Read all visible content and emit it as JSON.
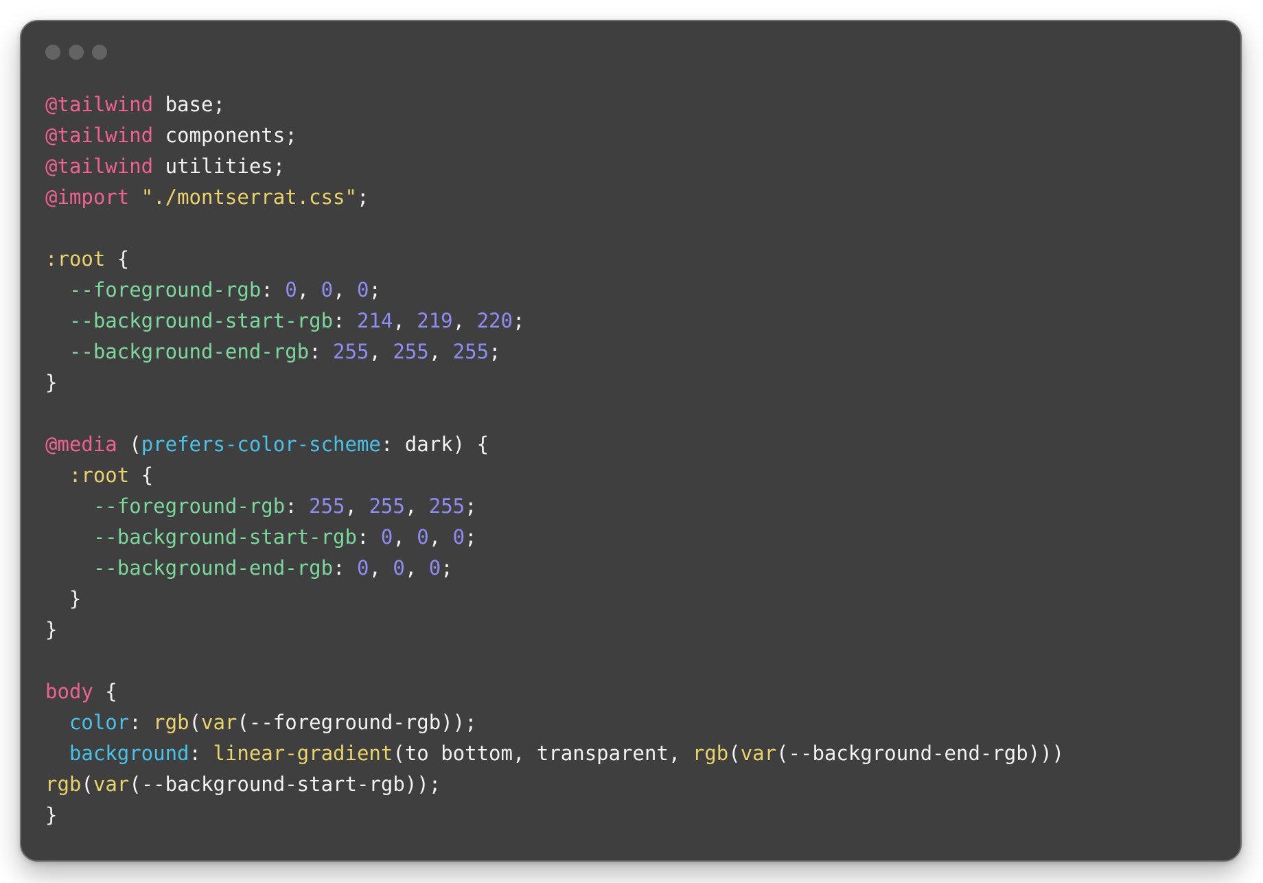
{
  "window": {
    "controls": [
      "window-dot",
      "window-dot",
      "window-dot"
    ]
  },
  "theme": {
    "background": "#3f3f3f",
    "text": "#f2f2f2",
    "keyword": "#f06292",
    "pseudo": "#ead36a",
    "variable": "#7bd99c",
    "number": "#8f8cf2",
    "property": "#47c3ea",
    "function": "#ead36a",
    "string": "#ead36a"
  },
  "code": [
    [
      {
        "t": "@tailwind",
        "c": "keyword"
      },
      {
        "t": " base;",
        "c": "plain"
      }
    ],
    [
      {
        "t": "@tailwind",
        "c": "keyword"
      },
      {
        "t": " components;",
        "c": "plain"
      }
    ],
    [
      {
        "t": "@tailwind",
        "c": "keyword"
      },
      {
        "t": " utilities;",
        "c": "plain"
      }
    ],
    [
      {
        "t": "@import",
        "c": "keyword"
      },
      {
        "t": " ",
        "c": "plain"
      },
      {
        "t": "\"./montserrat.css\"",
        "c": "string"
      },
      {
        "t": ";",
        "c": "plain"
      }
    ],
    [],
    [
      {
        "t": ":root",
        "c": "pseudo"
      },
      {
        "t": " {",
        "c": "plain"
      }
    ],
    [
      {
        "t": "  ",
        "c": "plain"
      },
      {
        "t": "--foreground-rgb",
        "c": "var"
      },
      {
        "t": ": ",
        "c": "plain"
      },
      {
        "t": "0",
        "c": "number"
      },
      {
        "t": ", ",
        "c": "plain"
      },
      {
        "t": "0",
        "c": "number"
      },
      {
        "t": ", ",
        "c": "plain"
      },
      {
        "t": "0",
        "c": "number"
      },
      {
        "t": ";",
        "c": "plain"
      }
    ],
    [
      {
        "t": "  ",
        "c": "plain"
      },
      {
        "t": "--background-start-rgb",
        "c": "var"
      },
      {
        "t": ": ",
        "c": "plain"
      },
      {
        "t": "214",
        "c": "number"
      },
      {
        "t": ", ",
        "c": "plain"
      },
      {
        "t": "219",
        "c": "number"
      },
      {
        "t": ", ",
        "c": "plain"
      },
      {
        "t": "220",
        "c": "number"
      },
      {
        "t": ";",
        "c": "plain"
      }
    ],
    [
      {
        "t": "  ",
        "c": "plain"
      },
      {
        "t": "--background-end-rgb",
        "c": "var"
      },
      {
        "t": ": ",
        "c": "plain"
      },
      {
        "t": "255",
        "c": "number"
      },
      {
        "t": ", ",
        "c": "plain"
      },
      {
        "t": "255",
        "c": "number"
      },
      {
        "t": ", ",
        "c": "plain"
      },
      {
        "t": "255",
        "c": "number"
      },
      {
        "t": ";",
        "c": "plain"
      }
    ],
    [
      {
        "t": "}",
        "c": "plain"
      }
    ],
    [],
    [
      {
        "t": "@media",
        "c": "keyword"
      },
      {
        "t": " (",
        "c": "plain"
      },
      {
        "t": "prefers-color-scheme",
        "c": "prop"
      },
      {
        "t": ": dark) {",
        "c": "plain"
      }
    ],
    [
      {
        "t": "  ",
        "c": "plain"
      },
      {
        "t": ":root",
        "c": "pseudo"
      },
      {
        "t": " {",
        "c": "plain"
      }
    ],
    [
      {
        "t": "    ",
        "c": "plain"
      },
      {
        "t": "--foreground-rgb",
        "c": "var"
      },
      {
        "t": ": ",
        "c": "plain"
      },
      {
        "t": "255",
        "c": "number"
      },
      {
        "t": ", ",
        "c": "plain"
      },
      {
        "t": "255",
        "c": "number"
      },
      {
        "t": ", ",
        "c": "plain"
      },
      {
        "t": "255",
        "c": "number"
      },
      {
        "t": ";",
        "c": "plain"
      }
    ],
    [
      {
        "t": "    ",
        "c": "plain"
      },
      {
        "t": "--background-start-rgb",
        "c": "var"
      },
      {
        "t": ": ",
        "c": "plain"
      },
      {
        "t": "0",
        "c": "number"
      },
      {
        "t": ", ",
        "c": "plain"
      },
      {
        "t": "0",
        "c": "number"
      },
      {
        "t": ", ",
        "c": "plain"
      },
      {
        "t": "0",
        "c": "number"
      },
      {
        "t": ";",
        "c": "plain"
      }
    ],
    [
      {
        "t": "    ",
        "c": "plain"
      },
      {
        "t": "--background-end-rgb",
        "c": "var"
      },
      {
        "t": ": ",
        "c": "plain"
      },
      {
        "t": "0",
        "c": "number"
      },
      {
        "t": ", ",
        "c": "plain"
      },
      {
        "t": "0",
        "c": "number"
      },
      {
        "t": ", ",
        "c": "plain"
      },
      {
        "t": "0",
        "c": "number"
      },
      {
        "t": ";",
        "c": "plain"
      }
    ],
    [
      {
        "t": "  }",
        "c": "plain"
      }
    ],
    [
      {
        "t": "}",
        "c": "plain"
      }
    ],
    [],
    [
      {
        "t": "body",
        "c": "keyword"
      },
      {
        "t": " {",
        "c": "plain"
      }
    ],
    [
      {
        "t": "  ",
        "c": "plain"
      },
      {
        "t": "color",
        "c": "prop"
      },
      {
        "t": ": ",
        "c": "plain"
      },
      {
        "t": "rgb",
        "c": "func"
      },
      {
        "t": "(",
        "c": "plain"
      },
      {
        "t": "var",
        "c": "func"
      },
      {
        "t": "(--foreground-rgb));",
        "c": "plain"
      }
    ],
    [
      {
        "t": "  ",
        "c": "plain"
      },
      {
        "t": "background",
        "c": "prop"
      },
      {
        "t": ": ",
        "c": "plain"
      },
      {
        "t": "linear-gradient",
        "c": "func"
      },
      {
        "t": "(to bottom, transparent, ",
        "c": "plain"
      },
      {
        "t": "rgb",
        "c": "func"
      },
      {
        "t": "(",
        "c": "plain"
      },
      {
        "t": "var",
        "c": "func"
      },
      {
        "t": "(--background-end-rgb)))",
        "c": "plain"
      }
    ],
    [
      {
        "t": "rgb",
        "c": "func"
      },
      {
        "t": "(",
        "c": "plain"
      },
      {
        "t": "var",
        "c": "func"
      },
      {
        "t": "(--background-start-rgb));",
        "c": "plain"
      }
    ],
    [
      {
        "t": "}",
        "c": "plain"
      }
    ]
  ]
}
